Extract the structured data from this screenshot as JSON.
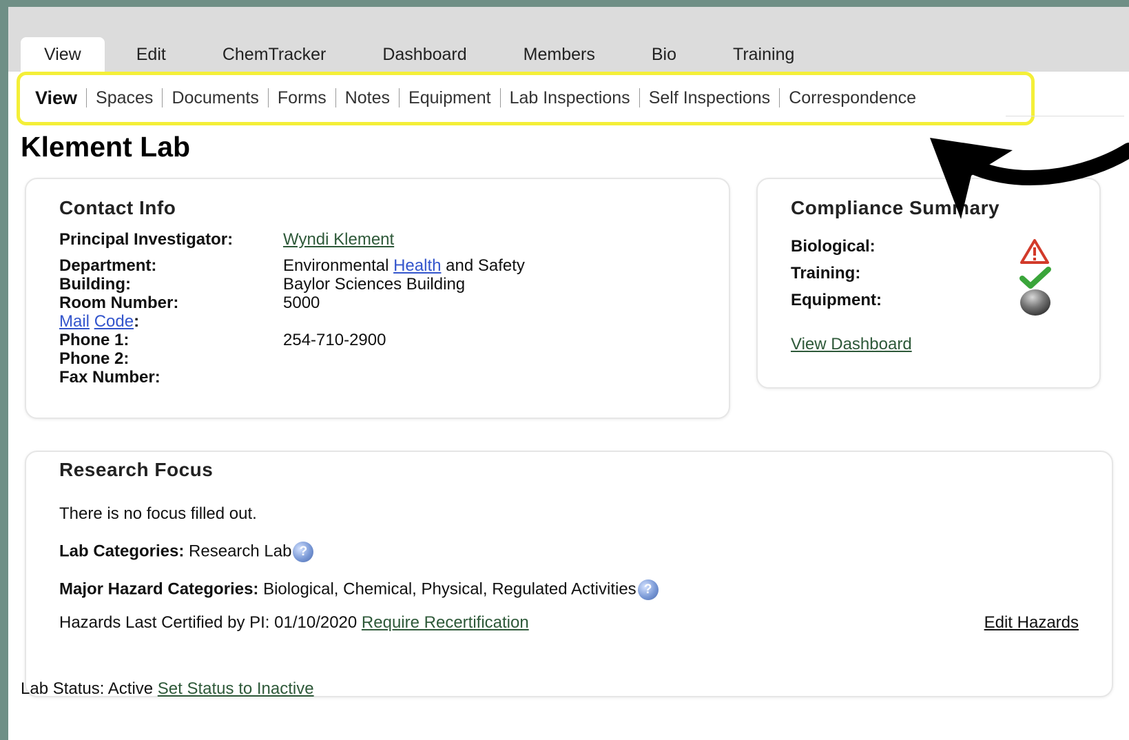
{
  "tabs": [
    {
      "label": "View",
      "active": true
    },
    {
      "label": "Edit"
    },
    {
      "label": "ChemTracker"
    },
    {
      "label": "Dashboard"
    },
    {
      "label": "Members"
    },
    {
      "label": "Bio"
    },
    {
      "label": "Training"
    }
  ],
  "subnav": [
    "View",
    "Spaces",
    "Documents",
    "Forms",
    "Notes",
    "Equipment",
    "Lab Inspections",
    "Self Inspections",
    "Correspondence"
  ],
  "page": {
    "title": "Klement Lab"
  },
  "contact": {
    "heading": "Contact Info",
    "pi_label": "Principal Investigator:",
    "pi_value": "Wyndi Klement",
    "dept_label": "Department:",
    "dept_value_pre": "Environmental",
    "dept_value_link": "Health",
    "dept_value_post": "and Safety",
    "building_label": "Building:",
    "building_value": "Baylor Sciences Building",
    "room_label": "Room Number:",
    "room_value": "5000",
    "mail_link": "Mail",
    "code_link": "Code",
    "mail_colon": ":",
    "phone1_label": "Phone 1:",
    "phone1_value": "254-710-2900",
    "phone2_label": "Phone 2:",
    "fax_label": "Fax Number:"
  },
  "compliance": {
    "heading": "Compliance Summary",
    "biological_label": "Biological:",
    "training_label": "Training:",
    "equipment_label": "Equipment:",
    "biological_icon": "warning-icon",
    "training_icon": "check-icon",
    "equipment_icon": "gray-circle-icon",
    "dashboard_link": "View Dashboard"
  },
  "research": {
    "heading": "Research Focus",
    "focus_text": "There is no focus filled out.",
    "lab_cat_label": "Lab Categories:",
    "lab_cat_value": "Research Lab",
    "hazard_label": "Major Hazard Categories:",
    "hazard_value": "Biological, Chemical, Physical, Regulated Activities",
    "certified_text": "Hazards Last Certified by PI: 01/10/2020",
    "recert_link": "Require Recertification",
    "edit_hazards_link": "Edit Hazards"
  },
  "status": {
    "text": "Lab Status: Active",
    "link": "Set Status to Inactive"
  },
  "colors": {
    "highlight": "#f4ef38",
    "link_green": "#2e5939",
    "link_blue": "#3355cc"
  }
}
